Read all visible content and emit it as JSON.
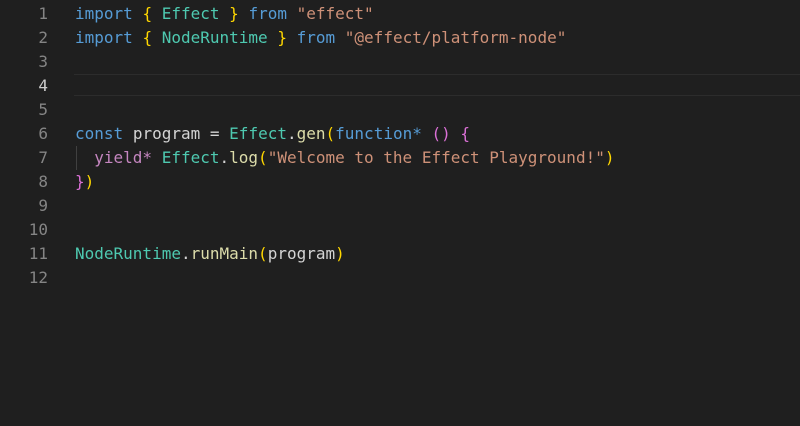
{
  "gutter": {
    "line_numbers": [
      "1",
      "2",
      "3",
      "4",
      "5",
      "6",
      "7",
      "8",
      "9",
      "10",
      "11",
      "12"
    ]
  },
  "code": {
    "line1": {
      "kw": "import",
      "brace_open": "{",
      "name": "Effect",
      "brace_close": "}",
      "from": "from",
      "source": "\"effect\""
    },
    "line2": {
      "kw": "import",
      "brace_open": "{",
      "name": "NodeRuntime",
      "brace_close": "}",
      "from": "from",
      "source": "\"@effect/platform-node\""
    },
    "line6": {
      "kw": "const",
      "var": "program",
      "eq": "=",
      "obj": "Effect",
      "dot": ".",
      "method": "gen",
      "paren_open": "(",
      "fkw": "function*",
      "args": "()",
      "brace_open": "{"
    },
    "line7": {
      "yield": "yield*",
      "obj": "Effect",
      "dot": ".",
      "method": "log",
      "paren_open": "(",
      "str": "\"Welcome to the Effect Playground!\"",
      "paren_close": ")"
    },
    "line8": {
      "brace_close": "}",
      "paren_close": ")"
    },
    "line11": {
      "obj": "NodeRuntime",
      "dot": ".",
      "method": "runMain",
      "paren_open": "(",
      "arg": "program",
      "paren_close": ")"
    }
  },
  "colors": {
    "background": "#1f1f1f",
    "keyword": "#569cd6",
    "control_keyword": "#c586c0",
    "type": "#4ec9b0",
    "function": "#dcdcaa",
    "variable": "#9cdcfe",
    "string": "#ce9178",
    "bracket_level1": "#ffd700",
    "bracket_level2": "#da70d6"
  }
}
